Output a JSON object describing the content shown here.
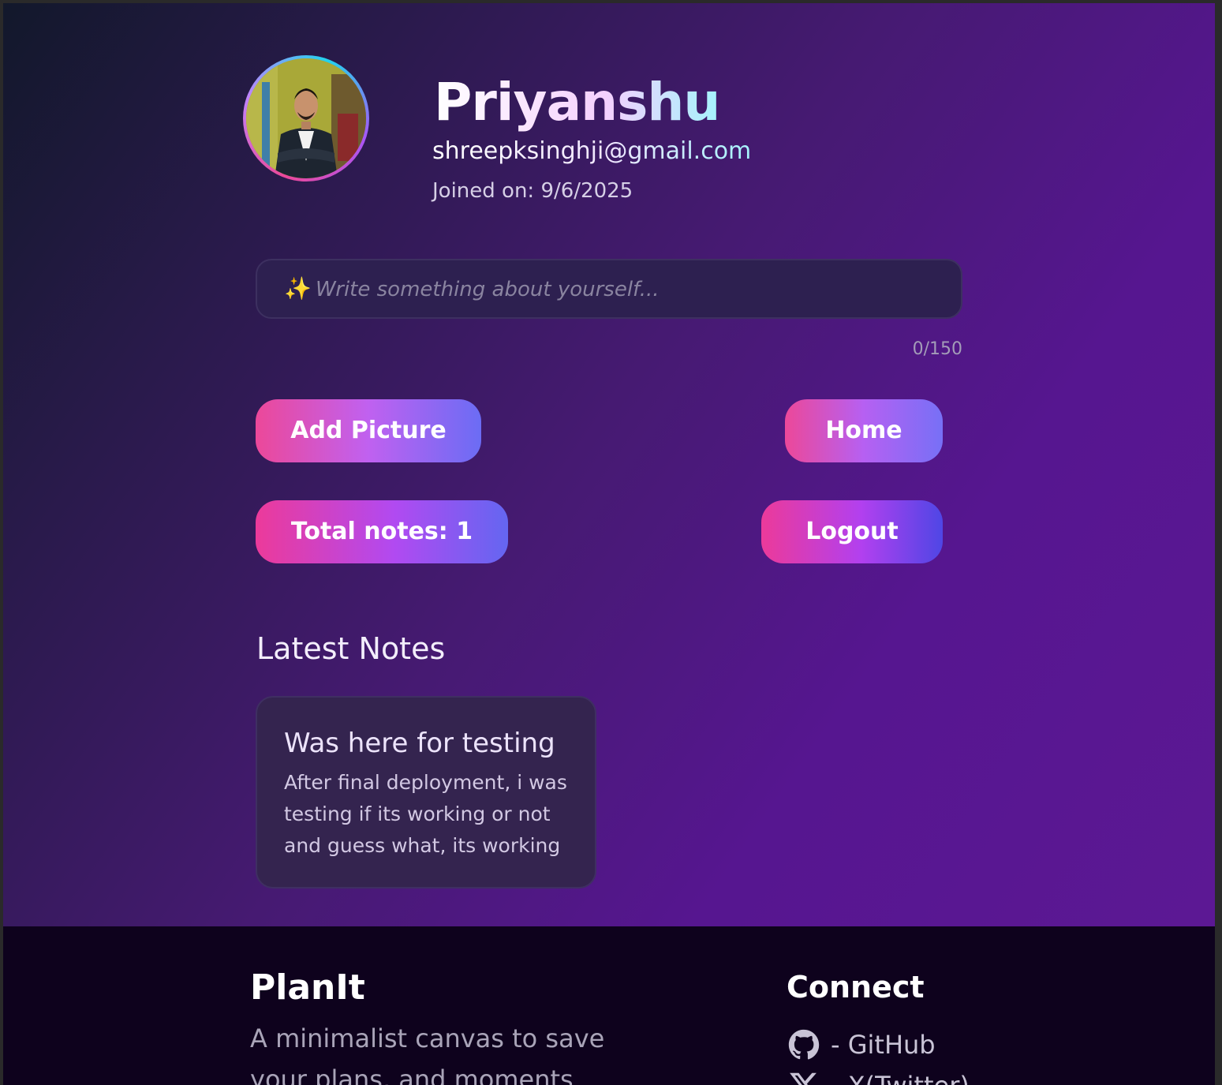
{
  "profile": {
    "name": "Priyanshu",
    "email": "shreepksinghji@gmail.com",
    "joined_label": "Joined on:",
    "joined_date": "9/6/2025",
    "avatar_icon": "profile-photo"
  },
  "bio": {
    "sparkle_icon": "✨",
    "placeholder": "Write something about yourself...",
    "value": "",
    "char_count": "0/150"
  },
  "actions": {
    "add_picture_label": "Add Picture",
    "home_label": "Home",
    "total_notes_label": "Total notes: 1",
    "logout_label": "Logout"
  },
  "notes_section": {
    "heading": "Latest Notes",
    "notes": [
      {
        "title": "Was here for testing",
        "body": "After final deployment, i was testing if its working or not and guess what, its working"
      }
    ]
  },
  "footer": {
    "brand": "PlanIt",
    "tagline": "A minimalist canvas to save your plans, and moments",
    "connect_heading": "Connect",
    "links": [
      {
        "icon": "github-icon",
        "label": "- GitHub"
      },
      {
        "icon": "x-icon",
        "label": "- X(Twitter)"
      }
    ]
  },
  "colors": {
    "background_start": "#12182b",
    "background_end": "#5c1894",
    "accent_pink": "#ec4899",
    "accent_indigo": "#6466f1",
    "footer_bg": "#0e021d"
  }
}
